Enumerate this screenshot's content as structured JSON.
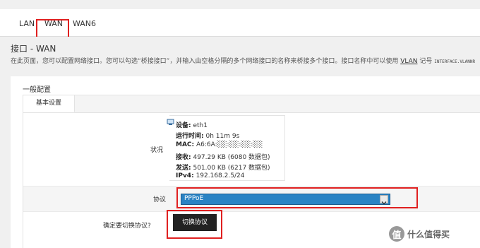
{
  "tabs": [
    {
      "label": "LAN"
    },
    {
      "label": "WAN"
    },
    {
      "label": "WAN6"
    }
  ],
  "page": {
    "title": "接口 - WAN",
    "desc_prefix": "在此页面，您可以配置网络接口。您可以勾选“桥接接口”，并输入由空格分隔的多个网络接口的名称来桥接多个接口。接口名称中可以使用",
    "desc_vlan": "VLAN",
    "desc_note": "记号",
    "desc_code": "INTERFACE.VLANNR"
  },
  "section": {
    "title": "一般配置",
    "subtab": "基本设置"
  },
  "status": {
    "label": "状况",
    "device_key": "设备:",
    "device_value": "eth1",
    "uptime_key": "运行时间:",
    "uptime_value": "0h 11m 9s",
    "mac_key": "MAC:",
    "mac_value": "A6:6A:░░:░░:░░:░░",
    "rx_key": "接收:",
    "rx_value": "497.29 KB (6080 数据包)",
    "tx_key": "发送:",
    "tx_value": "501.00 KB (6217 数据包)",
    "ipv4_key": "IPv4:",
    "ipv4_value": "192.168.2.5/24"
  },
  "protocol": {
    "label": "协议",
    "selected": "PPPoE"
  },
  "switch_protocol": {
    "label": "确定要切换协议?",
    "button": "切换协议"
  },
  "watermark": {
    "logo": "值",
    "text": "什么值得买"
  },
  "colors": {
    "highlight": "#e02020",
    "select_bg": "#2a83c4",
    "button_bg": "#222222"
  }
}
